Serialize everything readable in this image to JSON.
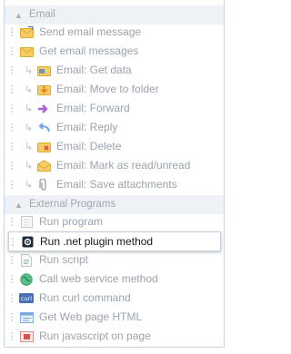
{
  "sections": {
    "email": {
      "title": "Email",
      "items": [
        {
          "label": "Send email message"
        },
        {
          "label": "Get email messages"
        }
      ],
      "children": [
        {
          "label": "Email: Get data"
        },
        {
          "label": "Email: Move to folder"
        },
        {
          "label": "Email: Forward"
        },
        {
          "label": "Email: Reply"
        },
        {
          "label": "Email: Delete"
        },
        {
          "label": "Email: Mark as read/unread"
        },
        {
          "label": "Email: Save attachments"
        }
      ]
    },
    "external": {
      "title": "External Programs",
      "items": [
        {
          "label": "Run program"
        },
        {
          "label": "Run .net plugin method"
        },
        {
          "label": "Run script"
        },
        {
          "label": "Call web service method"
        },
        {
          "label": "Run curl command"
        },
        {
          "label": "Get Web page HTML"
        },
        {
          "label": "Run javascript on page"
        }
      ]
    }
  },
  "colors": {
    "accent_blue": "#3a7bd5",
    "envelope_yellow": "#f2c14e",
    "selected_text": "#1a1a1a"
  }
}
